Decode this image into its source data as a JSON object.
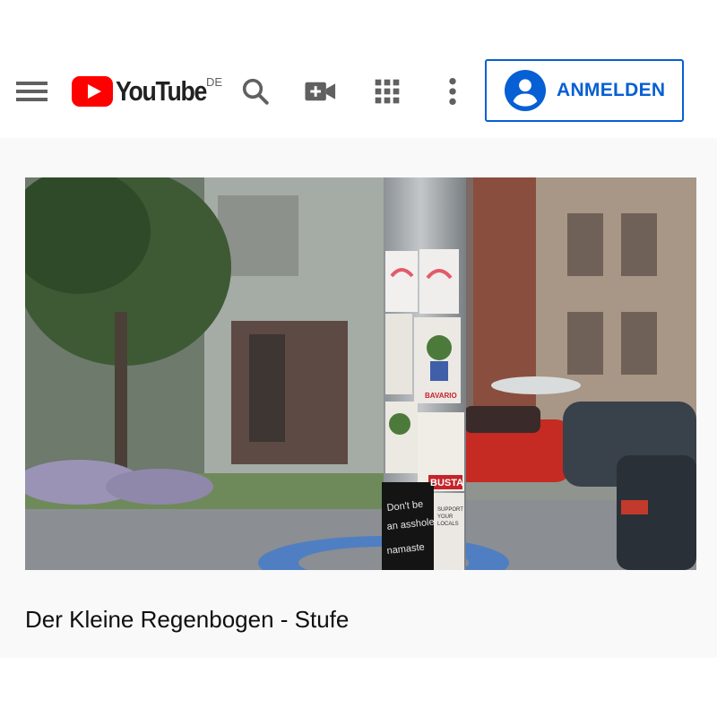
{
  "header": {
    "logo_text": "YouTube",
    "country_code": "DE",
    "signin_label": "ANMELDEN"
  },
  "icons": {
    "menu": "hamburger-menu-icon",
    "search": "search-icon",
    "upload": "video-camera-plus-icon",
    "apps": "apps-grid-icon",
    "more": "more-vertical-icon",
    "account": "account-circle-icon"
  },
  "colors": {
    "brand_red": "#ff0000",
    "link_blue": "#065fd4",
    "icon_gray": "#606060",
    "background": "#f9f9f9"
  },
  "video": {
    "title": "Der Kleine Regenbogen - Stufe",
    "thumbnail_sticker_texts": [
      "BAVARIO",
      "BUSTA",
      "Don't be an asshole",
      "namaste",
      "SUPPORT YOUR LOCALS"
    ]
  }
}
